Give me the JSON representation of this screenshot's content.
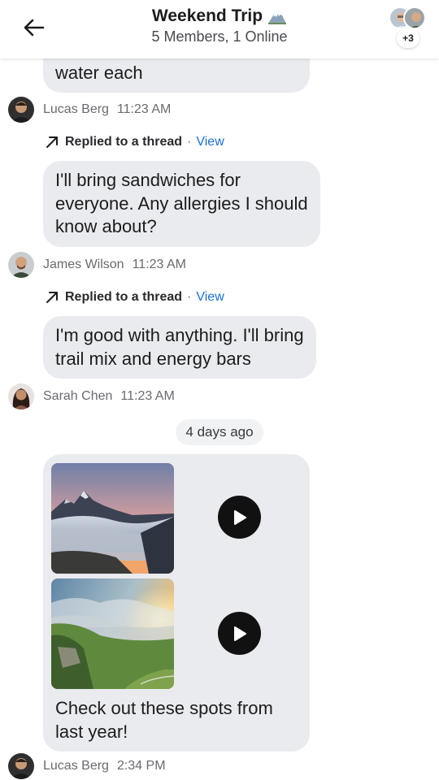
{
  "header": {
    "title": "Weekend Trip",
    "title_icon": "mountain-emoji",
    "subtitle": "5 Members, 1 Online",
    "more_count": "+3"
  },
  "messages": [
    {
      "text_lines": [
        "water each"
      ],
      "sender": "Lucas Berg",
      "time": "11:23 AM"
    },
    {
      "reply_label": "Replied to a thread",
      "reply_link": "View",
      "text_lines": [
        "I'll bring sandwiches for",
        "everyone. Any allergies I should",
        "know about?"
      ],
      "sender": "James Wilson",
      "time": "11:23 AM"
    },
    {
      "reply_label": "Replied to a thread",
      "reply_link": "View",
      "text_lines": [
        "I'm good with anything. I'll bring",
        "trail mix and energy bars"
      ],
      "sender": "Sarah Chen",
      "time": "11:23 AM"
    }
  ],
  "date_divider": "4 days ago",
  "media_message": {
    "caption_lines": [
      "Check out these spots from",
      "last year!"
    ],
    "sender": "Lucas Berg",
    "time": "2:34 PM",
    "videos": [
      "mountain-sunset-sea-of-clouds",
      "green-cliffs-sunset"
    ]
  },
  "colors": {
    "bubble": "#eaebee",
    "link": "#1a6fd6",
    "meta_text": "#6a6a70"
  }
}
